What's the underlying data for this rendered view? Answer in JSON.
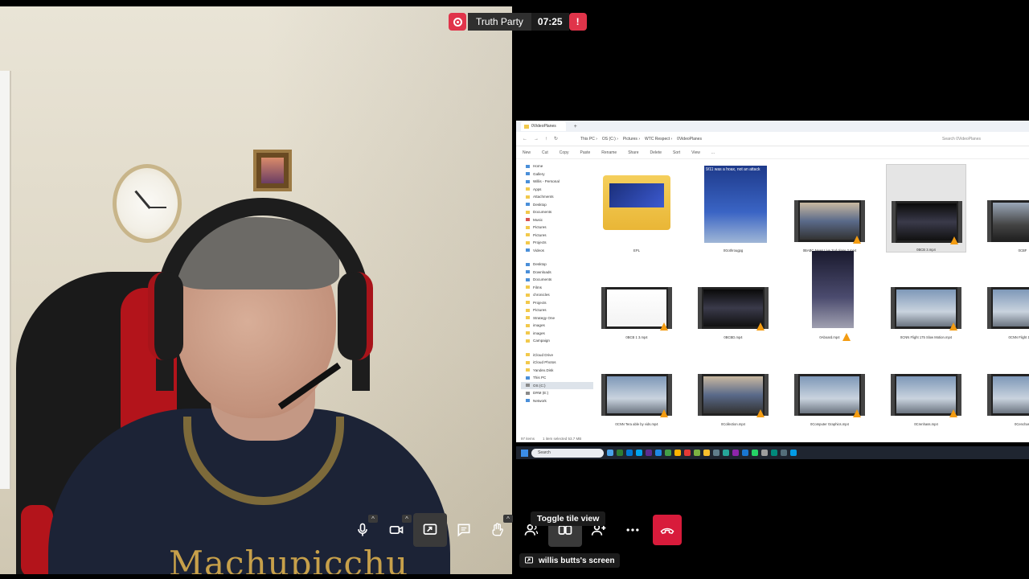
{
  "meeting": {
    "title": "Truth Party",
    "timer": "07:25"
  },
  "camera": {
    "shirt_text": "Machupicchu"
  },
  "toolbar": {
    "tooltip": "Toggle tile view",
    "screen_label": "willis butts's screen"
  },
  "explorer": {
    "tab_title": "0VideoPlanes",
    "nav": {
      "back": "←",
      "forward": "→",
      "up": "↑",
      "refresh": "↻"
    },
    "breadcrumbs": [
      "This PC",
      "OS (C:)",
      "Pictures",
      "WTC Respect",
      "0VideoPlanes"
    ],
    "search_placeholder": "Search 0VideoPlanes",
    "commands": [
      "New",
      "Cut",
      "Copy",
      "Paste",
      "Rename",
      "Share",
      "Delete",
      "Sort",
      "View",
      "..."
    ],
    "sidebar": [
      {
        "label": "Home",
        "icon": "home-icon",
        "color": "blue"
      },
      {
        "label": "Gallery",
        "icon": "gallery-icon",
        "color": "blue"
      },
      {
        "label": "Willis - Personal",
        "icon": "cloud-icon",
        "color": "blue"
      },
      {
        "label": "Apps",
        "icon": "folder-icon",
        "color": "yellow"
      },
      {
        "label": "Attachments",
        "icon": "folder-icon",
        "color": "yellow"
      },
      {
        "label": "Desktop",
        "icon": "folder-icon",
        "color": "blue"
      },
      {
        "label": "Documents",
        "icon": "folder-icon",
        "color": "yellow"
      },
      {
        "label": "Music",
        "icon": "folder-icon",
        "color": "red"
      },
      {
        "label": "Pictures",
        "icon": "folder-icon",
        "color": "yellow"
      },
      {
        "label": "Pictures",
        "icon": "folder-icon",
        "color": "yellow"
      },
      {
        "label": "Projects",
        "icon": "folder-icon",
        "color": "yellow"
      },
      {
        "label": "Videos",
        "icon": "folder-icon",
        "color": "blue"
      },
      {
        "gap": true
      },
      {
        "label": "Desktop",
        "icon": "folder-icon",
        "color": "blue"
      },
      {
        "label": "Downloads",
        "icon": "folder-icon",
        "color": "blue"
      },
      {
        "label": "Documents",
        "icon": "folder-icon",
        "color": "blue"
      },
      {
        "label": "Films",
        "icon": "folder-icon",
        "color": "yellow"
      },
      {
        "label": "chronicles",
        "icon": "folder-icon",
        "color": "yellow"
      },
      {
        "label": "Projects",
        "icon": "folder-icon",
        "color": "yellow"
      },
      {
        "label": "Pictures",
        "icon": "folder-icon",
        "color": "yellow"
      },
      {
        "label": "Strategy One",
        "icon": "folder-icon",
        "color": "yellow"
      },
      {
        "label": "images",
        "icon": "folder-icon",
        "color": "yellow"
      },
      {
        "label": "images",
        "icon": "folder-icon",
        "color": "yellow"
      },
      {
        "label": "Campaign",
        "icon": "folder-icon",
        "color": "yellow"
      },
      {
        "gap": true
      },
      {
        "label": "iCloud Drive",
        "icon": "folder-icon",
        "color": "yellow"
      },
      {
        "label": "iCloud Photos",
        "icon": "folder-icon",
        "color": "yellow"
      },
      {
        "label": "Yandex.Disk",
        "icon": "folder-icon",
        "color": "yellow"
      },
      {
        "label": "This PC",
        "icon": "pc-icon",
        "color": "blue"
      },
      {
        "label": "OS (C:)",
        "icon": "drive-icon",
        "color": "gray",
        "selected": true
      },
      {
        "label": "DRM (E:)",
        "icon": "drive-icon",
        "color": "gray"
      },
      {
        "label": "Network",
        "icon": "network-icon",
        "color": "blue"
      }
    ],
    "files": [
      {
        "name": "EPL",
        "kind": "folder"
      },
      {
        "name": "0Gothrougpg",
        "kind": "poster",
        "caption": "9/11 was a hoax, not an attack"
      },
      {
        "name": "0BABC News Live 2nd plane 2.mp4",
        "kind": "video",
        "tone": "news"
      },
      {
        "name": "0BCB 3.mp4",
        "kind": "video",
        "tone": "dark",
        "selected": true
      },
      {
        "name": "0CBF",
        "kind": "video",
        "tone": "smoke"
      },
      {
        "name": "0BCB 1 3.mp4",
        "kind": "video",
        "tone": "text"
      },
      {
        "name": "0BCBD.mp4",
        "kind": "video",
        "tone": "dark"
      },
      {
        "name": "0Aboard.mp4",
        "kind": "tall",
        "tone": "dark"
      },
      {
        "name": "0CNN Flight 175 Slow Motion.mp4",
        "kind": "video",
        "tone": "sky"
      },
      {
        "name": "0CNN Flight 175 S",
        "kind": "video",
        "tone": "sky"
      },
      {
        "name": "0CNN Tera able by vids.mp4",
        "kind": "video",
        "tone": "sky"
      },
      {
        "name": "0Collection.mp4",
        "kind": "video",
        "tone": "news"
      },
      {
        "name": "0Computer Graphics.mp4",
        "kind": "video",
        "tone": "sky"
      },
      {
        "name": "0Crenhass.mp4",
        "kind": "video",
        "tone": "sky"
      },
      {
        "name": "0Cenchast",
        "kind": "video",
        "tone": "sky"
      }
    ],
    "status": [
      "97 items",
      "1 item selected  53.7 MB"
    ]
  },
  "taskbar": {
    "search_label": "Search"
  },
  "colors": {
    "accent_red": "#e0344a",
    "hangup_red": "#d81b3b"
  }
}
